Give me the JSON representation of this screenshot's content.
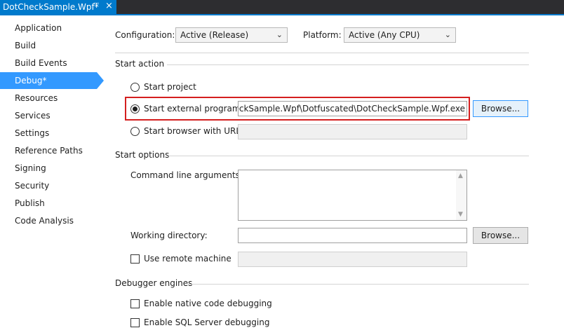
{
  "tab": {
    "title": "DotCheckSample.Wpf*",
    "pin_icon": "⊤",
    "close_icon": "×"
  },
  "sidebar": {
    "items": [
      {
        "label": "Application"
      },
      {
        "label": "Build"
      },
      {
        "label": "Build Events"
      },
      {
        "label": "Debug*",
        "active": true
      },
      {
        "label": "Resources"
      },
      {
        "label": "Services"
      },
      {
        "label": "Settings"
      },
      {
        "label": "Reference Paths"
      },
      {
        "label": "Signing"
      },
      {
        "label": "Security"
      },
      {
        "label": "Publish"
      },
      {
        "label": "Code Analysis"
      }
    ]
  },
  "config": {
    "configuration_label": "Configuration:",
    "configuration_value": "Active (Release)",
    "platform_label": "Platform:",
    "platform_value": "Active (Any CPU)"
  },
  "start_action": {
    "title": "Start action",
    "start_project": "Start project",
    "start_external": "Start external program:",
    "external_path": "DotCheckSample.Wpf\\Dotfuscated\\DotCheckSample.Wpf.exe",
    "browse1": "Browse...",
    "start_browser": "Start browser with URL:",
    "url_value": ""
  },
  "start_options": {
    "title": "Start options",
    "cmd_args_label": "Command line arguments:",
    "cmd_args_value": "",
    "working_dir_label": "Working directory:",
    "working_dir_value": "",
    "browse2": "Browse...",
    "remote_label": "Use remote machine",
    "remote_value": ""
  },
  "debugger_engines": {
    "title": "Debugger engines",
    "native": "Enable native code debugging",
    "sql": "Enable SQL Server debugging"
  },
  "colors": {
    "accent": "#007acc",
    "selection": "#3399ff",
    "highlight_box": "#d41f1f"
  }
}
